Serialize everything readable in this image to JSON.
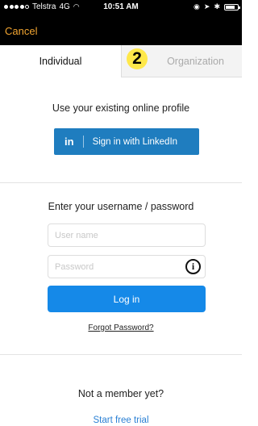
{
  "status_bar": {
    "carrier": "Telstra",
    "network": "4G",
    "time": "10:51 AM",
    "battery_level": 0.75
  },
  "nav": {
    "cancel_label": "Cancel"
  },
  "tabs": [
    {
      "label": "Individual",
      "active": true
    },
    {
      "label": "Organization",
      "active": false,
      "badge": "2"
    }
  ],
  "profile_section": {
    "prompt": "Use your existing online profile",
    "linkedin_icon": "in",
    "linkedin_label": "Sign in with LinkedIn"
  },
  "login_section": {
    "prompt": "Enter your username / password",
    "username_placeholder": "User name",
    "password_placeholder": "Password",
    "login_label": "Log in",
    "forgot_label": "Forgot Password?"
  },
  "signup_section": {
    "prompt": "Not a member yet?",
    "trial_label": "Start free trial"
  },
  "colors": {
    "accent": "#f2a531",
    "linkedin": "#1f7dbf",
    "primary": "#1589e8",
    "link": "#2b80d4",
    "badge": "#ffe84a"
  }
}
